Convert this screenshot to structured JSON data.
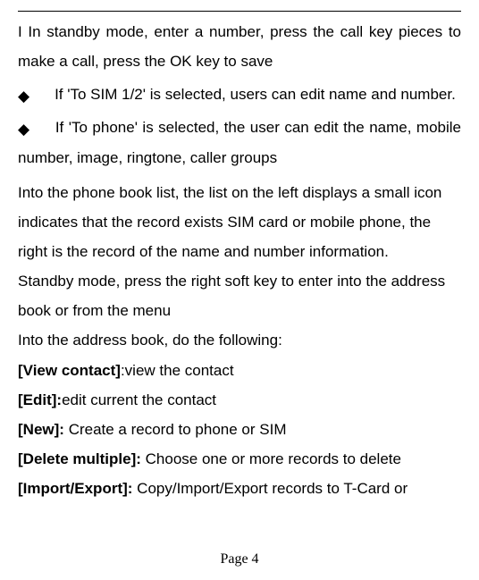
{
  "intro": "I In standby mode, enter a number, press the call key pieces to make a call, press the OK key to save",
  "bullets": [
    "If 'To SIM 1/2' is selected, users can edit name and number.",
    "If 'To phone' is selected, the user can edit the name, mobile number, image, ringtone, caller groups"
  ],
  "para_list": "Into the phone book list, the list on the left displays a small icon indicates that the record exists SIM card or mobile phone, the right is the record of the name and number information.",
  "para_standby": "Standby mode, press the right soft key to enter into the address book or from the menu",
  "para_into": "Into the address book, do the following:",
  "items": [
    {
      "label": "[View contact]",
      "sep": ":",
      "desc": "view the contact"
    },
    {
      "label": "[Edit]:",
      "sep": "",
      "desc": "edit current the contact"
    },
    {
      "label": "[New]:",
      "sep": " ",
      "desc": "Create a record to phone or SIM"
    },
    {
      "label": "[Delete multiple]:",
      "sep": " ",
      "desc": "Choose one or more records to delete"
    },
    {
      "label": "[Import/Export]:",
      "sep": " ",
      "desc": "Copy/Import/Export records to T-Card or"
    }
  ],
  "footer": "Page 4"
}
